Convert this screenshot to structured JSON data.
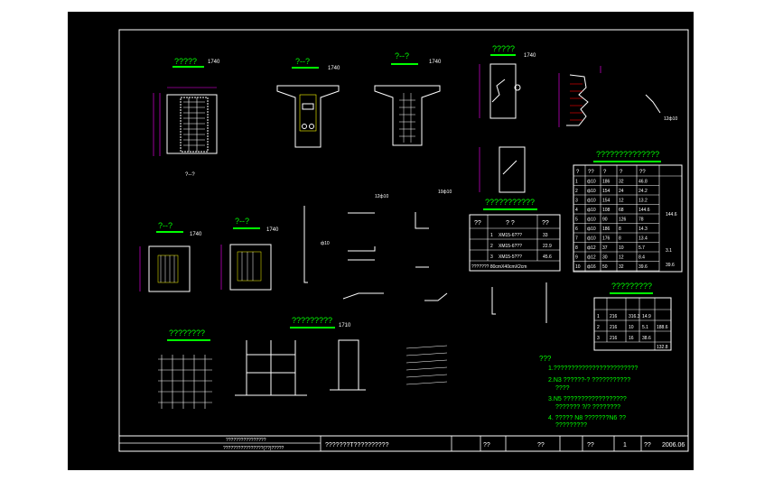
{
  "colors": {
    "frame": "#ffffff",
    "accent": "#00ff00",
    "cyan": "#00ffff",
    "magenta": "#ff00ff",
    "yellow": "#ffff00",
    "red": "#ff0000",
    "bg": "#000000"
  },
  "views": {
    "v1": {
      "title": "?????",
      "scale": "1740"
    },
    "v2": {
      "title": "?--?",
      "scale": "1740"
    },
    "v3": {
      "title": "?--?",
      "scale": "1740"
    },
    "v4": {
      "title": "?????",
      "scale": "1740"
    },
    "v5": {
      "title": "?--?",
      "scale": "1740"
    },
    "v6": {
      "title": "?--?",
      "scale": "1740"
    },
    "v7": {
      "title": "?????????",
      "scale": "1710"
    },
    "v8": {
      "title": "????????"
    }
  },
  "section_label": "?--?",
  "table_small": {
    "title": "???????????",
    "headers": [
      "??",
      "? ?",
      "??"
    ],
    "rows": [
      [
        "1",
        "XM15-6???",
        "33"
      ],
      [
        "2",
        "XM15-6???",
        "22.9"
      ],
      [
        "3",
        "XM15-5???",
        "45.6"
      ]
    ],
    "footer": "??????? 80cmX40cmX2cm"
  },
  "table_big": {
    "title": "??????????????",
    "headers": [
      "?",
      "??",
      "?",
      "?",
      "??"
    ],
    "rows": [
      [
        "1",
        "ф10",
        "186",
        "32",
        "46.8"
      ],
      [
        "2",
        "ф10",
        "154",
        "24",
        "24.2"
      ],
      [
        "3",
        "ф10",
        "154",
        "12",
        "13.2"
      ],
      [
        "4",
        "ф10",
        "108",
        "68",
        "144.6"
      ],
      [
        "5",
        "ф10",
        "90",
        "126",
        "78"
      ],
      [
        "6",
        "ф10",
        "186",
        "8",
        "14.3"
      ],
      [
        "7",
        "ф10",
        "176",
        "8",
        "13.4"
      ],
      [
        "8",
        "ф12",
        "37",
        "10",
        "5.7"
      ],
      [
        "9",
        "ф12",
        "30",
        "12",
        "8.4"
      ],
      [
        "10",
        "ф16",
        "50",
        "32",
        "39.6"
      ]
    ],
    "total": "144.6",
    "total2": "3.1",
    "total3": "39.6"
  },
  "table_bottom": {
    "title": "?????????",
    "rows": [
      [
        "1",
        "216",
        "316.3",
        "14.9"
      ],
      [
        "2",
        "216",
        "10",
        "5.1"
      ],
      [
        "3",
        "216",
        "16",
        "38.6"
      ]
    ],
    "total": "188.6",
    "total2": "132.8"
  },
  "notes": [
    "???",
    "1.????????????????????????",
    "2.N3 ??????-? ???????????",
    "????",
    "3.N5 ??????????????????",
    "??????? ?/? ????????",
    "4. ????? N8 ???????N6 ??",
    "?????????"
  ],
  "title_block": {
    "company_line1": "????????????????",
    "company_line2": "????????????????(??)?????",
    "drawing_title": "???????T??????????",
    "review": "??",
    "audit": "??",
    "sheet_label": "??",
    "sheet_no": "1",
    "date_label": "??",
    "date": "2006.06"
  },
  "rebar_labels": {
    "r1": "12ф10",
    "r2": "10ф10",
    "r3": "ф10",
    "r4": "12ф10"
  }
}
